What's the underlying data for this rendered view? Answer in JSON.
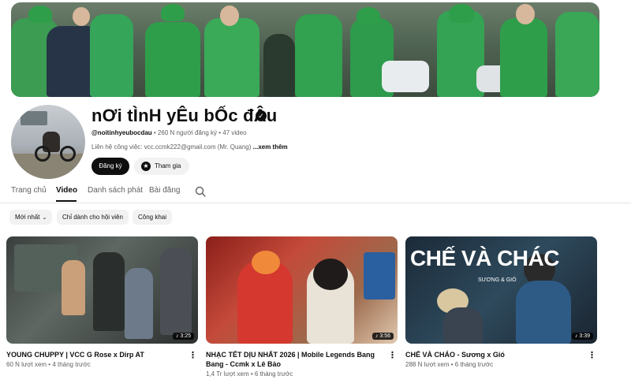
{
  "channel": {
    "name": "nƠi tÌnH yÊu bỐc đÂu",
    "handle": "@noitinhyeubocdau",
    "meta_rest": " • 260 N người đăng ký • 47 video",
    "description": "Liên hệ công việc: vcc.ccmk222@gmail.com (Mr. Quang)",
    "more_label": "...xem thêm",
    "subscribe_label": "Đăng ký",
    "join_label": "Tham gia"
  },
  "tabs": [
    {
      "label": "Trang chủ"
    },
    {
      "label": "Video"
    },
    {
      "label": "Danh sách phát"
    },
    {
      "label": "Bài đăng"
    }
  ],
  "chips": [
    {
      "label": "Mới nhất"
    },
    {
      "label": "Chỉ dành cho hội viên"
    },
    {
      "label": "Công khai"
    }
  ],
  "videos": [
    {
      "title": "YOUNG CHUPPY | VCC G Rose x Dirp AT",
      "views": "60 N lượt xem",
      "age": "4 tháng trước",
      "duration": "3:25"
    },
    {
      "title": "NHẠC TẾT DỊU NHẤT 2026 | Mobile Legends Bang Bang - Ccmk x Lê Bảo",
      "views": "1,4 Tr lượt xem",
      "age": "6 tháng trước",
      "duration": "3:56"
    },
    {
      "title": "CHẾ VÀ CHÁO - Sương x Gió",
      "views": "288 N lượt xem",
      "age": "6 tháng trước",
      "duration": "3:39",
      "thumb_title": "CHẾ VÀ CHÁC",
      "thumb_sub": "SƯƠNG & GIÓ"
    }
  ],
  "icons": {
    "verified": "verified-check-icon",
    "search": "search-icon",
    "join": "star-icon",
    "more": "more-vert-icon"
  },
  "colors": {
    "text": "#0f0f0f",
    "secondary": "#606060",
    "chip_bg": "#f2f2f2"
  }
}
